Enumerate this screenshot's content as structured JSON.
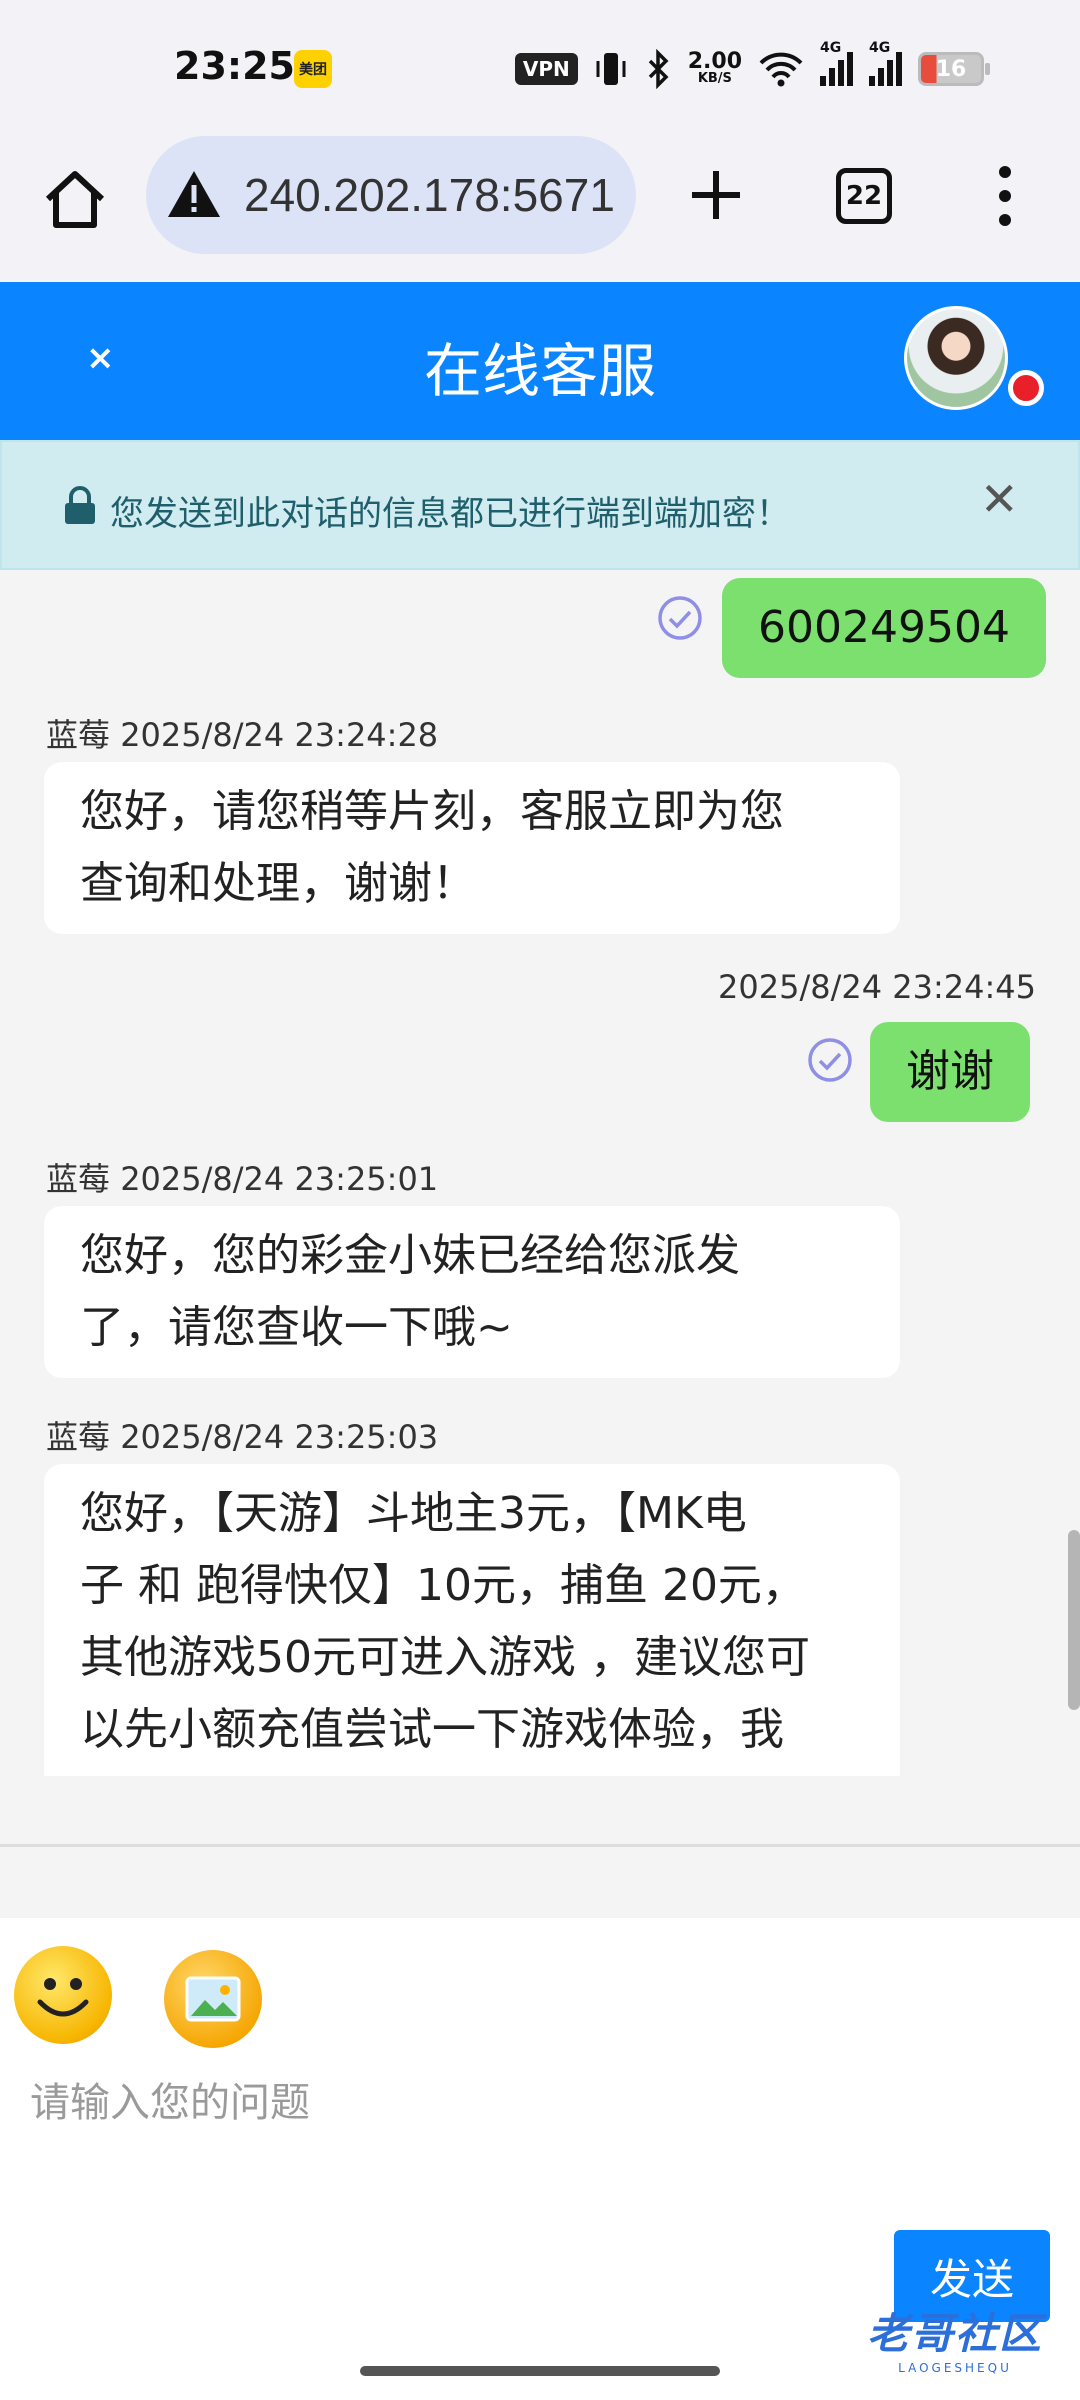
{
  "status_bar": {
    "time": "23:25",
    "app_badge": "美团",
    "vpn": "VPN",
    "net_speed": "2.00",
    "net_unit": "KB/S",
    "sig1_label": "4G",
    "sig2_label": "4G",
    "battery": "16"
  },
  "browser": {
    "url": "240.202.178:5671",
    "tab_count": "22"
  },
  "chat": {
    "title": "在线客服",
    "close": "×",
    "encryption_notice": "您发送到此对话的信息都已进行端到端加密！",
    "encryption_close": "✕",
    "messages": [
      {
        "side": "user",
        "text": "600249504"
      },
      {
        "side": "agent",
        "sender": "蓝莓",
        "time": "2025/8/24 23:24:28",
        "line1": "您好，请您稍等片刻，客服立即为您",
        "line2": "查询和处理，谢谢！"
      },
      {
        "side": "user",
        "time": "2025/8/24 23:24:45",
        "text": "谢谢"
      },
      {
        "side": "agent",
        "sender": "蓝莓",
        "time": "2025/8/24 23:25:01",
        "line1": "您好，您的彩金小妹已经给您派发",
        "line2": "了，请您查收一下哦~"
      },
      {
        "side": "agent",
        "sender": "蓝莓",
        "time": "2025/8/24 23:25:03",
        "line1": "您好，【天游】斗地主3元，【MK电",
        "line2": "子 和 跑得快仅】10元，捕鱼 20元，",
        "line3": "其他游戏50元可进入游戏 ，建议您可",
        "line4": "以先小额充值尝试一下游戏体验，我"
      }
    ]
  },
  "composer": {
    "placeholder": "请输入您的问题",
    "send_label": "发送"
  },
  "watermark": {
    "main": "老哥社区",
    "sub": "LAOGESHEQU"
  },
  "colors": {
    "header_blue": "#0a84ff",
    "user_bubble": "#7be06e",
    "banner_bg": "#d1ecf1"
  }
}
